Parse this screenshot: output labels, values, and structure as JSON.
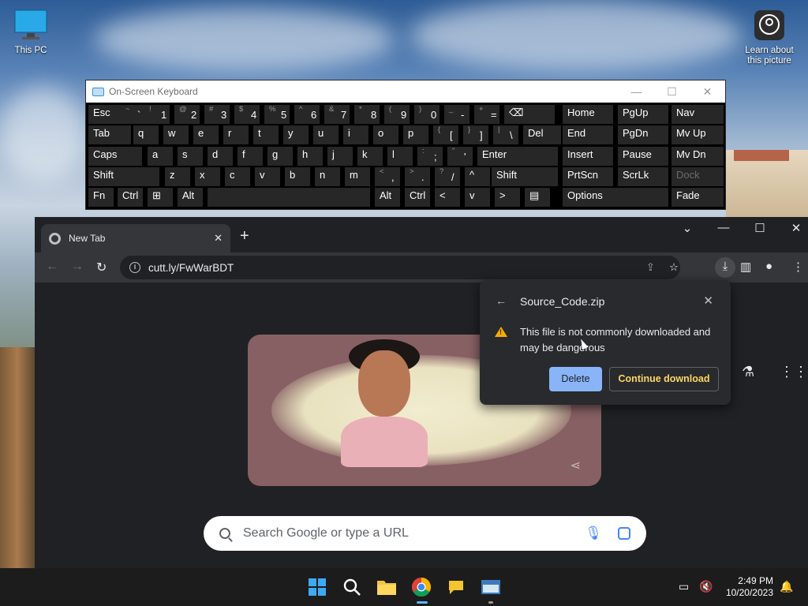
{
  "desktop": {
    "icons": [
      {
        "label": "This PC"
      },
      {
        "label": "Learn about this picture"
      }
    ]
  },
  "osk": {
    "title": "On-Screen Keyboard",
    "rows": [
      [
        "Esc",
        "~ `",
        "! 1",
        "@ 2",
        "# 3",
        "$ 4",
        "% 5",
        "^ 6",
        "& 7",
        "* 8",
        "( 9",
        ") 0",
        "_ -",
        "+ =",
        "⌫",
        "Home",
        "PgUp",
        "Nav"
      ],
      [
        "Tab",
        "q",
        "w",
        "e",
        "r",
        "t",
        "y",
        "u",
        "i",
        "o",
        "p",
        "{ [",
        "} ]",
        "| \\",
        "Del",
        "End",
        "PgDn",
        "Mv Up"
      ],
      [
        "Caps",
        "a",
        "s",
        "d",
        "f",
        "g",
        "h",
        "j",
        "k",
        "l",
        ": ;",
        "\" '",
        "Enter",
        "Insert",
        "Pause",
        "Mv Dn"
      ],
      [
        "Shift",
        "z",
        "x",
        "c",
        "v",
        "b",
        "n",
        "m",
        "< ,",
        "> .",
        "? /",
        "^",
        "Shift",
        "PrtScn",
        "ScrLk",
        "Dock"
      ],
      [
        "Fn",
        "Ctrl",
        "⊞",
        "Alt",
        "",
        "Alt",
        "Ctrl",
        "<",
        "v",
        ">",
        "▤",
        "Options",
        "Fade"
      ]
    ]
  },
  "browser": {
    "tab_title": "New Tab",
    "url": "cutt.ly/FwWarBDT",
    "search_placeholder": "Search Google or type a URL"
  },
  "download_popup": {
    "filename": "Source_Code.zip",
    "message": "This file is not commonly downloaded and may be dangerous",
    "delete_label": "Delete",
    "continue_label": "Continue download",
    "colors": {
      "delete_bg": "#8ab4f8",
      "continue_text": "#fdd663",
      "warn": "#f9ab00"
    }
  },
  "taskbar": {
    "time": "2:49 PM",
    "date": "10/20/2023"
  }
}
